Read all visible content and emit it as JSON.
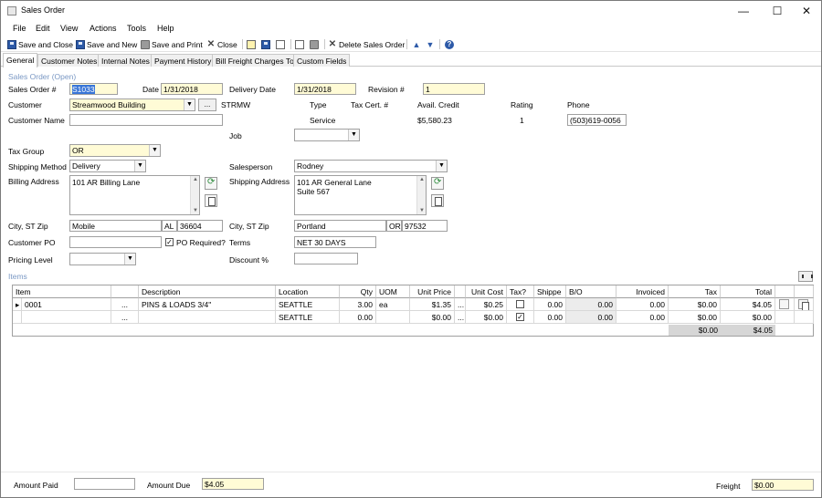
{
  "window": {
    "title": "Sales Order",
    "minimize": "—",
    "maximize": "☐",
    "close": "✕"
  },
  "menu": [
    "File",
    "Edit",
    "View",
    "Actions",
    "Tools",
    "Help"
  ],
  "toolbar": {
    "save_close": "Save and Close",
    "save_new": "Save and New",
    "save_print": "Save and Print",
    "close": "Close",
    "delete": "Delete Sales Order"
  },
  "tabs": [
    "General",
    "Customer Notes",
    "Internal Notes",
    "Payment History",
    "Bill Freight Charges To",
    "Custom Fields"
  ],
  "header": {
    "section_title": "Sales Order (Open)",
    "sales_order_label": "Sales Order #",
    "sales_order": "S1033",
    "date_label": "Date",
    "date": "1/31/2018",
    "delivery_date_label": "Delivery Date",
    "delivery_date": "1/31/2018",
    "revision_label": "Revision #",
    "revision": "1",
    "customer_label": "Customer",
    "customer": "Streamwood Building",
    "customer_code": "STRMW",
    "ellipsis": "...",
    "customer_name_label": "Customer Name",
    "customer_name": "",
    "type_label": "Type",
    "type": "Service",
    "tax_cert_label": "Tax Cert. #",
    "avail_credit_label": "Avail. Credit",
    "avail_credit": "$5,580.23",
    "rating_label": "Rating",
    "rating": "1",
    "phone_label": "Phone",
    "phone": "(503)619-0056",
    "job_label": "Job",
    "job": "",
    "tax_group_label": "Tax Group",
    "tax_group": "OR",
    "shipping_method_label": "Shipping Method",
    "shipping_method": "Delivery",
    "salesperson_label": "Salesperson",
    "salesperson": "Rodney",
    "billing_address_label": "Billing Address",
    "billing_address": "101 AR Billing Lane",
    "shipping_address_label": "Shipping Address",
    "shipping_address_1": "101 AR General Lane",
    "shipping_address_2": "Suite 567",
    "city_label": "City, ST Zip",
    "bill_city": "Mobile",
    "bill_state": "AL",
    "bill_zip": "36604",
    "ship_city_label": "City, ST Zip",
    "ship_city": "Portland",
    "ship_state": "OR",
    "ship_zip": "97532",
    "customer_po_label": "Customer PO",
    "customer_po": "",
    "po_required_label": "PO Required?",
    "po_required": "✓",
    "terms_label": "Terms",
    "terms": "NET 30 DAYS",
    "pricing_level_label": "Pricing Level",
    "pricing_level": "",
    "discount_label": "Discount %",
    "discount": ""
  },
  "items": {
    "title": "Items",
    "columns": [
      "Item",
      "",
      "Description",
      "Location",
      "Qty",
      "UOM",
      "Unit Price",
      "",
      "Unit Cost",
      "Tax?",
      "Shippe",
      "B/O",
      "Invoiced",
      "Tax",
      "Total"
    ],
    "rows": [
      {
        "marker": "▸",
        "item": "0001",
        "btn": "...",
        "description": "PINS & LOADS 3/4\"",
        "location": "SEATTLE",
        "qty": "3.00",
        "uom": "ea",
        "unit_price": "$1.35",
        "ell": "...",
        "unit_cost": "$0.25",
        "tax": "",
        "shipped": "0.00",
        "bo": "0.00",
        "invoiced": "0.00",
        "tax_amt": "$0.00",
        "total": "$4.05"
      },
      {
        "marker": "",
        "item": "",
        "btn": "...",
        "description": "",
        "location": "SEATTLE",
        "qty": "0.00",
        "uom": "",
        "unit_price": "$0.00",
        "ell": "...",
        "unit_cost": "$0.00",
        "tax": "✓",
        "shipped": "0.00",
        "bo": "0.00",
        "invoiced": "0.00",
        "tax_amt": "$0.00",
        "total": "$0.00"
      }
    ],
    "totals": {
      "tax": "$0.00",
      "total": "$4.05"
    }
  },
  "footer": {
    "amount_paid_label": "Amount Paid",
    "amount_paid": "",
    "amount_due_label": "Amount Due",
    "amount_due": "$4.05",
    "freight_label": "Freight",
    "freight": "$0.00"
  }
}
